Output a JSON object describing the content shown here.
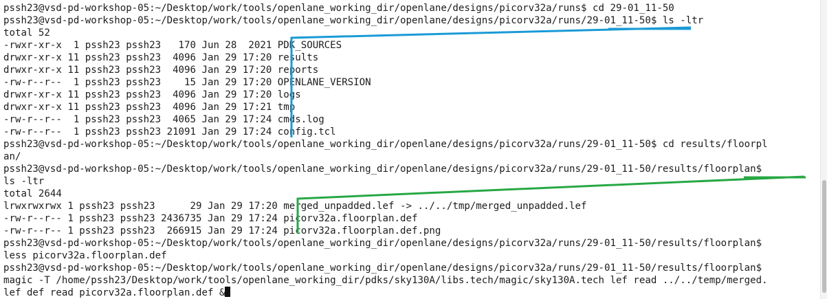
{
  "terminal": {
    "lines": [
      "pssh23@vsd-pd-workshop-05:~/Desktop/work/tools/openlane_working_dir/openlane/designs/picorv32a/runs$ cd 29-01_11-50",
      "pssh23@vsd-pd-workshop-05:~/Desktop/work/tools/openlane_working_dir/openlane/designs/picorv32a/runs/29-01_11-50$ ls -ltr",
      "total 52",
      "-rwxr-xr-x  1 pssh23 pssh23   170 Jun 28  2021 PDK_SOURCES",
      "drwxr-xr-x 11 pssh23 pssh23  4096 Jan 29 17:20 results",
      "drwxr-xr-x 11 pssh23 pssh23  4096 Jan 29 17:20 reports",
      "-rw-r--r--  1 pssh23 pssh23    15 Jan 29 17:20 OPENLANE_VERSION",
      "drwxr-xr-x 11 pssh23 pssh23  4096 Jan 29 17:20 logs",
      "drwxr-xr-x 11 pssh23 pssh23  4096 Jan 29 17:21 tmp",
      "-rw-r--r--  1 pssh23 pssh23  4065 Jan 29 17:24 cmds.log",
      "-rw-r--r--  1 pssh23 pssh23 21091 Jan 29 17:24 config.tcl",
      "pssh23@vsd-pd-workshop-05:~/Desktop/work/tools/openlane_working_dir/openlane/designs/picorv32a/runs/29-01_11-50$ cd results/floorpl",
      "an/",
      "pssh23@vsd-pd-workshop-05:~/Desktop/work/tools/openlane_working_dir/openlane/designs/picorv32a/runs/29-01_11-50/results/floorplan$",
      "ls -ltr",
      "total 2644",
      "lrwxrwxrwx 1 pssh23 pssh23      29 Jan 29 17:20 merged_unpadded.lef -> ../../tmp/merged_unpadded.lef",
      "-rw-r--r-- 1 pssh23 pssh23 2436735 Jan 29 17:24 picorv32a.floorplan.def",
      "-rw-r--r-- 1 pssh23 pssh23  266915 Jan 29 17:24 picorv32a.floorplan.def.png",
      "pssh23@vsd-pd-workshop-05:~/Desktop/work/tools/openlane_working_dir/openlane/designs/picorv32a/runs/29-01_11-50/results/floorplan$",
      "less picorv32a.floorplan.def",
      "pssh23@vsd-pd-workshop-05:~/Desktop/work/tools/openlane_working_dir/openlane/designs/picorv32a/runs/29-01_11-50/results/floorplan$",
      "magic -T /home/pssh23/Desktop/work/tools/openlane_working_dir/pdks/sky130A/libs.tech/magic/sky130A.tech lef read ../../temp/merged.",
      "lef def read picorv32a.floorplan.def &"
    ]
  },
  "annotations": {
    "blue_color": "#1a9ad6",
    "green_color": "#27a844"
  }
}
